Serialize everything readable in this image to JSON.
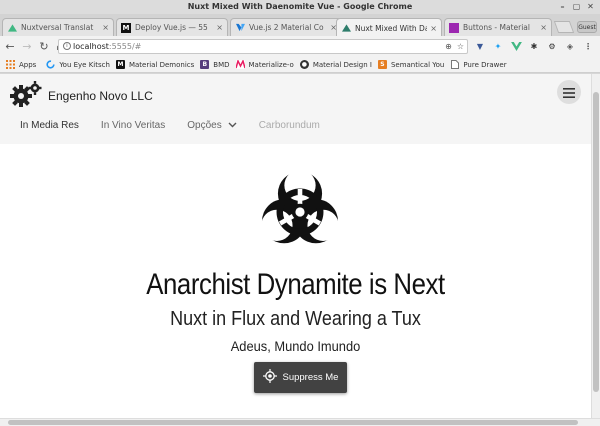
{
  "window": {
    "title": "Nuxt Mixed With Daenomite Vue - Google Chrome"
  },
  "tabs": [
    {
      "label": "Nuxtversal Translat",
      "icon": "nuxt-favicon"
    },
    {
      "label": "Deploy Vue.js — 55",
      "icon": "medium-favicon"
    },
    {
      "label": "Vue.js 2 Material Co",
      "icon": "vuetify-favicon"
    },
    {
      "label": "Nuxt Mixed With Dae",
      "icon": "nuxt-favicon",
      "active": true
    },
    {
      "label": "Buttons - Material",
      "icon": "material-favicon"
    }
  ],
  "guest_label": "Guest",
  "address": {
    "host": "localhost",
    "path": ":5555/#"
  },
  "bookmarks": [
    {
      "label": "Apps",
      "icon": "apps-grid-icon",
      "color": "#e67e22"
    },
    {
      "label": "You Eye Kitsch",
      "icon": "circle-icon",
      "color": "#2196f3"
    },
    {
      "label": "Material Demonics",
      "icon": "medium-icon",
      "color": "#111111"
    },
    {
      "label": "BMD",
      "icon": "bootstrap-icon",
      "color": "#563d7c"
    },
    {
      "label": "Materialize-o",
      "icon": "materialize-icon",
      "color": "#e91e63"
    },
    {
      "label": "Material Design I",
      "icon": "github-icon",
      "color": "#333333"
    },
    {
      "label": "Semantical You",
      "icon": "semantic-icon",
      "color": "#e67e22"
    },
    {
      "label": "Pure Drawer",
      "icon": "page-icon",
      "color": "#777777"
    }
  ],
  "app": {
    "brand": "Engenho Novo LLC",
    "nav": [
      "In Media Res",
      "In Vino Veritas",
      "Opções",
      "Carborundum"
    ],
    "title": "Anarchist Dynamite is Next",
    "subtitle": "Nuxt in Flux and Wearing a Tux",
    "tagline": "Adeus, Mundo Imundo",
    "cta_label": "Suppress Me"
  },
  "colors": {
    "cta_bg": "#424242",
    "header_bg": "#f5f5f5",
    "hamburger_bg": "#dedede"
  }
}
